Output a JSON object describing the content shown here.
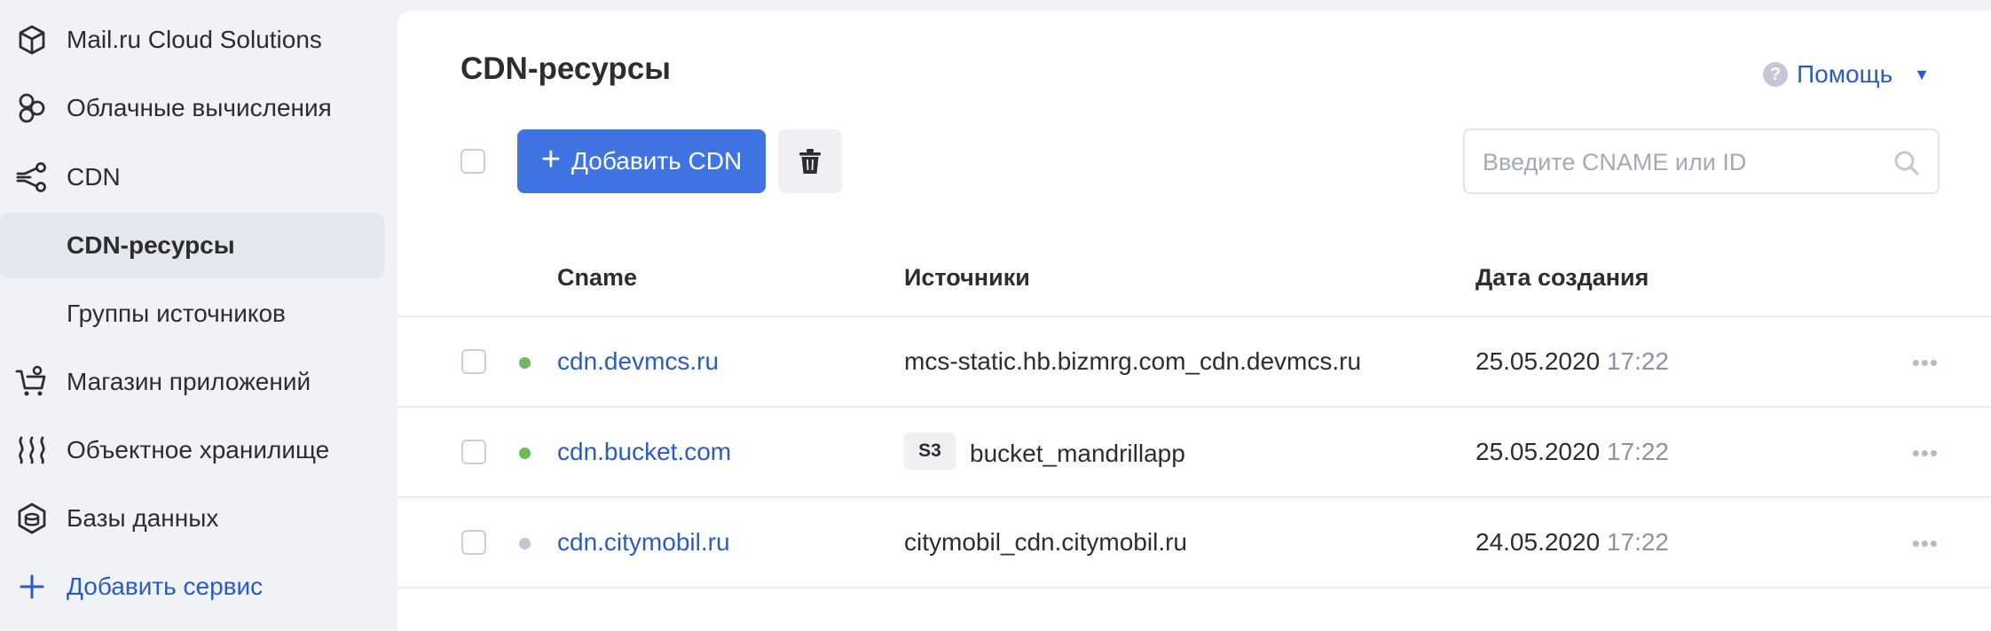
{
  "sidebar": {
    "items": [
      {
        "label": "Mail.ru Cloud Solutions",
        "icon": "cube-icon"
      },
      {
        "label": "Облачные вычисления",
        "icon": "cloud-compute-icon"
      },
      {
        "label": "CDN",
        "icon": "cdn-icon"
      },
      {
        "label": "CDN-ресурсы"
      },
      {
        "label": "Группы источников"
      },
      {
        "label": "Магазин приложений",
        "icon": "cart-icon"
      },
      {
        "label": "Объектное хранилище",
        "icon": "storage-icon"
      },
      {
        "label": "Базы данных",
        "icon": "database-icon"
      },
      {
        "label": "Добавить сервис",
        "icon": "plus-icon"
      }
    ]
  },
  "header": {
    "title": "CDN-ресурсы",
    "help_label": "Помощь",
    "help_icon": "?"
  },
  "toolbar": {
    "add_label": "Добавить CDN",
    "add_plus": "+",
    "search_placeholder": "Введите CNAME или ID"
  },
  "table": {
    "columns": [
      "Cname",
      "Источники",
      "Дата создания"
    ],
    "rows": [
      {
        "cname": "cdn.devmcs.ru",
        "status_color": "#6fb85f",
        "badge": "",
        "source": "mcs-static.hb.bizmrg.com_cdn.devmcs.ru",
        "date": "25.05.2020",
        "time": "17:22"
      },
      {
        "cname": "cdn.bucket.com",
        "status_color": "#6fb85f",
        "badge": "S3",
        "source": "bucket_mandrillapp",
        "date": "25.05.2020",
        "time": "17:22"
      },
      {
        "cname": "cdn.citymobil.ru",
        "status_color": "#c0c6d6",
        "badge": "",
        "source": "citymobil_cdn.citymobil.ru",
        "date": "24.05.2020",
        "time": "17:22"
      }
    ],
    "more_glyph": "•••"
  },
  "colors": {
    "accent": "#4074e3",
    "link": "#2a5cc7",
    "status_active": "#6fb85f",
    "status_inactive": "#c0c6d6"
  }
}
